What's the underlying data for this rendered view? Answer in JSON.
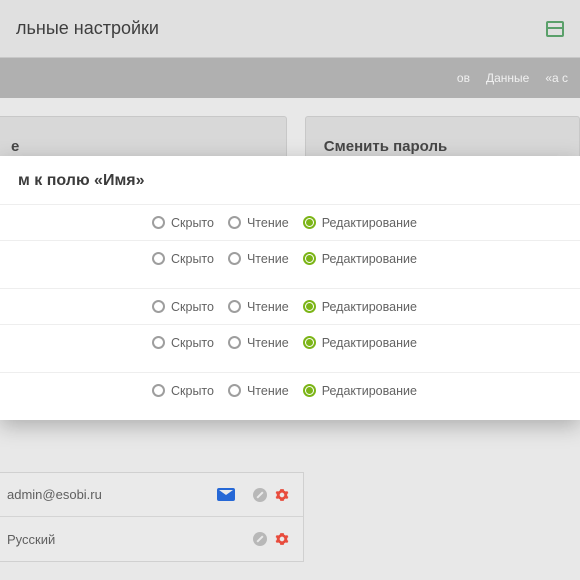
{
  "header": {
    "title": "льные настройки"
  },
  "tabs": {
    "t1": "ов",
    "t2": "Данные",
    "t3": "«а с"
  },
  "panels": {
    "left": "е",
    "right": "Сменить пароль"
  },
  "overlay": {
    "title": "м к полю «Имя»",
    "options": {
      "hidden": "Скрыто",
      "read": "Чтение",
      "edit": "Редактирование"
    }
  },
  "list": {
    "row1": "admin@esobi.ru",
    "row2": "Русский"
  }
}
